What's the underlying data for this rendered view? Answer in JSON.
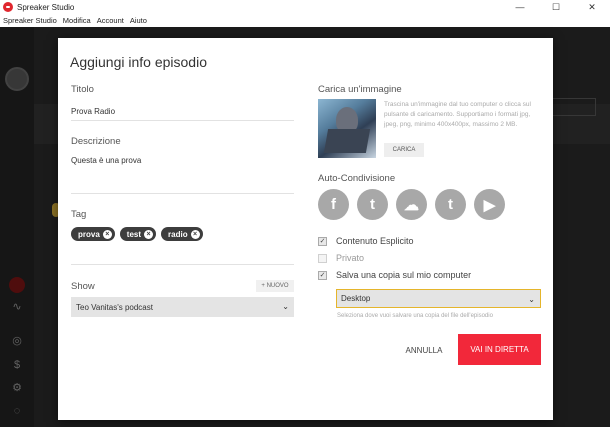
{
  "window": {
    "title": "Spreaker Studio",
    "minimize": "—",
    "maximize": "☐",
    "close": "✕"
  },
  "menu": [
    "Spreaker Studio",
    "Modifica",
    "Account",
    "Aiuto"
  ],
  "modal": {
    "title": "Aggiungi info episodio",
    "title_label": "Titolo",
    "title_value": "Prova Radio",
    "description_label": "Descrizione",
    "description_value": "Questa è una prova",
    "tags_label": "Tag",
    "tags": [
      "prova",
      "test",
      "radio"
    ],
    "tag_remove_glyph": "×",
    "show_label": "Show",
    "new_show_button": "+ NUOVO",
    "show_selected": "Teo Vanitas's podcast",
    "upload_label": "Carica un'immagine",
    "upload_description": "Trascina un'immagine dal tuo computer o clicca sul pulsante di caricamento. Supportiamo i formati jpg, jpeg, png, minimo 400x400px, massimo 2 MB.",
    "upload_button": "CARICA",
    "autoshare_label": "Auto-Condivisione",
    "social": [
      {
        "name": "facebook",
        "glyph": "f"
      },
      {
        "name": "twitter",
        "glyph": "t"
      },
      {
        "name": "soundcloud",
        "glyph": "☁"
      },
      {
        "name": "tumblr",
        "glyph": "t"
      },
      {
        "name": "youtube",
        "glyph": "▶"
      }
    ],
    "options": [
      {
        "label": "Contenuto Esplicito",
        "checked": true
      },
      {
        "label": "Privato",
        "checked": false
      },
      {
        "label": "Salva una copia sul mio computer",
        "checked": true
      }
    ],
    "save_location": "Desktop",
    "save_hint": "Seleziona dove vuoi salvare una copia del file dell'episodio",
    "cancel_button": "ANNULLA",
    "live_button": "VAI IN DIRETTA"
  },
  "colors": {
    "accent_red": "#f2283a",
    "select_focus": "#e5b52b",
    "social_grey": "#a8a8a8"
  }
}
